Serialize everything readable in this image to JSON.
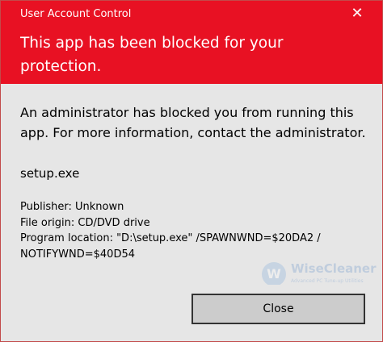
{
  "window": {
    "title": "User Account Control",
    "close_glyph": "✕"
  },
  "header": {
    "headline": "This app has been blocked for your protection.",
    "background_color": "#e81123"
  },
  "body": {
    "message": "An administrator has blocked you from running this app. For more information, contact the administrator.",
    "program_name": "setup.exe",
    "details": {
      "publisher": "Publisher: Unknown",
      "file_origin": "File origin: CD/DVD drive",
      "program_location_line1": "Program location: \"D:\\setup.exe\" /SPAWNWND=$20DA2 /",
      "program_location_line2": "NOTIFYWND=$40D54"
    }
  },
  "footer": {
    "close_label": "Close"
  },
  "watermark": {
    "logo_letter": "W",
    "name": "WiseCleaner",
    "tagline": "Advanced PC Tune-up Utilities"
  }
}
